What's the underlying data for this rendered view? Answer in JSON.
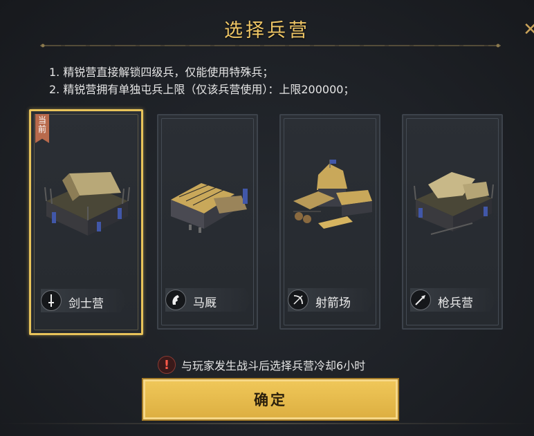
{
  "dialog": {
    "title": "选择兵营",
    "rules": [
      "1. 精锐营直接解锁四级兵，仅能使用特殊兵；",
      "2. 精锐营拥有单独屯兵上限（仅该兵营使用）：上限200000；"
    ],
    "current_badge": "当\n前",
    "warning": "与玩家发生战斗后选择兵营冷却6小时",
    "confirm_label": "确定"
  },
  "barracks": [
    {
      "label": "剑士营",
      "icon": "sword-icon",
      "selected": true
    },
    {
      "label": "马厩",
      "icon": "horse-head-icon",
      "selected": false
    },
    {
      "label": "射箭场",
      "icon": "bow-icon",
      "selected": false
    },
    {
      "label": "枪兵营",
      "icon": "spear-icon",
      "selected": false
    }
  ],
  "colors": {
    "accent_gold": "#e8c35a",
    "title_gold": "#f0c766",
    "badge": "#b86a4c",
    "warning_red": "#ff5a4a"
  }
}
